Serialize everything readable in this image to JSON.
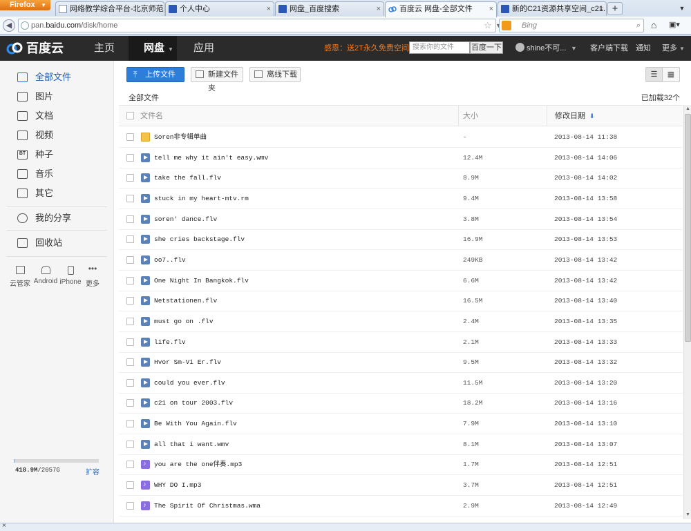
{
  "browser": {
    "menu_label": "Firefox",
    "tabs": [
      {
        "title": "网络教学综合平台-北京师范...",
        "active": false,
        "icon": "page-icon"
      },
      {
        "title": "个人中心",
        "active": false,
        "icon": "baidu-paw-icon"
      },
      {
        "title": "网盘_百度搜索",
        "active": false,
        "icon": "baidu-paw-icon"
      },
      {
        "title": "百度云 网盘-全部文件",
        "active": true,
        "icon": "baidu-cloud-icon"
      },
      {
        "title": "新的C21资源共享空间_c21...",
        "active": false,
        "icon": "baidu-paw-icon"
      }
    ],
    "url_prefix": "pan.",
    "url_domain": "baidu.com",
    "url_path": "/disk/home",
    "search_placeholder": "Bing",
    "new_tab": "+"
  },
  "header": {
    "logo": "百度云",
    "nav": [
      "主页",
      "网盘",
      "应用"
    ],
    "active_nav": "网盘",
    "promo": "感恩：送2T永久免费空间",
    "search_placeholder": "搜索你的文件",
    "search_button": "百度一下",
    "username": "shine不可...",
    "client_download": "客户端下载",
    "notifications": "通知",
    "more": "更多"
  },
  "sidebar": {
    "items": [
      {
        "label": "全部文件",
        "icon": "files-icon"
      },
      {
        "label": "图片",
        "icon": "image-icon"
      },
      {
        "label": "文档",
        "icon": "document-icon"
      },
      {
        "label": "视频",
        "icon": "video-icon"
      },
      {
        "label": "种子",
        "icon": "torrent-icon"
      },
      {
        "label": "音乐",
        "icon": "music-icon"
      },
      {
        "label": "其它",
        "icon": "other-icon"
      }
    ],
    "share": "我的分享",
    "recycle": "回收站",
    "devices": [
      {
        "label": "云管家",
        "icon": "desktop-icon"
      },
      {
        "label": "Android",
        "icon": "android-icon"
      },
      {
        "label": "iPhone",
        "icon": "iphone-icon"
      },
      {
        "label": "更多",
        "icon": "more-dots-icon"
      }
    ],
    "quota_used": "418.9M",
    "quota_total": "/2057G",
    "quota_fraction": 0.0002,
    "expand": "扩容"
  },
  "toolbar": {
    "upload": "上传文件",
    "new_folder": "新建文件夹",
    "offline": "离线下载"
  },
  "breadcrumb": "全部文件",
  "loaded_count": "已加载32个",
  "table": {
    "col_name": "文件名",
    "col_size": "大小",
    "col_date": "修改日期",
    "rows": [
      {
        "name": "Soren非专辑单曲",
        "size": "-",
        "date": "2013-08-14 11:38",
        "type": "folder"
      },
      {
        "name": "tell me why it ain't easy.wmv",
        "size": "12.4M",
        "date": "2013-08-14 14:06",
        "type": "video"
      },
      {
        "name": "take the fall.flv",
        "size": "8.9M",
        "date": "2013-08-14 14:02",
        "type": "video"
      },
      {
        "name": "stuck in my heart-mtv.rm",
        "size": "9.4M",
        "date": "2013-08-14 13:58",
        "type": "video"
      },
      {
        "name": "soren' dance.flv",
        "size": "3.8M",
        "date": "2013-08-14 13:54",
        "type": "video"
      },
      {
        "name": "she cries backstage.flv",
        "size": "16.9M",
        "date": "2013-08-14 13:53",
        "type": "video"
      },
      {
        "name": "oo7..flv",
        "size": "249KB",
        "date": "2013-08-14 13:42",
        "type": "video"
      },
      {
        "name": "One Night In Bangkok.flv",
        "size": "6.6M",
        "date": "2013-08-14 13:42",
        "type": "video"
      },
      {
        "name": "Netstationen.flv",
        "size": "16.5M",
        "date": "2013-08-14 13:40",
        "type": "video"
      },
      {
        "name": "must go on .flv",
        "size": "2.4M",
        "date": "2013-08-14 13:35",
        "type": "video"
      },
      {
        "name": "life.flv",
        "size": "2.1M",
        "date": "2013-08-14 13:33",
        "type": "video"
      },
      {
        "name": "Hvor Sm-Vi Er.flv",
        "size": "9.5M",
        "date": "2013-08-14 13:32",
        "type": "video"
      },
      {
        "name": "could you ever.flv",
        "size": "11.5M",
        "date": "2013-08-14 13:20",
        "type": "video"
      },
      {
        "name": "c21 on tour 2003.flv",
        "size": "18.2M",
        "date": "2013-08-14 13:16",
        "type": "video"
      },
      {
        "name": "Be With You Again.flv",
        "size": "7.9M",
        "date": "2013-08-14 13:10",
        "type": "video"
      },
      {
        "name": "all that i want.wmv",
        "size": "8.1M",
        "date": "2013-08-14 13:07",
        "type": "video"
      },
      {
        "name": "you are the one伴奏.mp3",
        "size": "1.7M",
        "date": "2013-08-14 12:51",
        "type": "audio"
      },
      {
        "name": "WHY DO I.mp3",
        "size": "3.7M",
        "date": "2013-08-14 12:51",
        "type": "audio"
      },
      {
        "name": "The Spirit Of Christmas.wma",
        "size": "2.9M",
        "date": "2013-08-14 12:49",
        "type": "audio"
      }
    ]
  }
}
